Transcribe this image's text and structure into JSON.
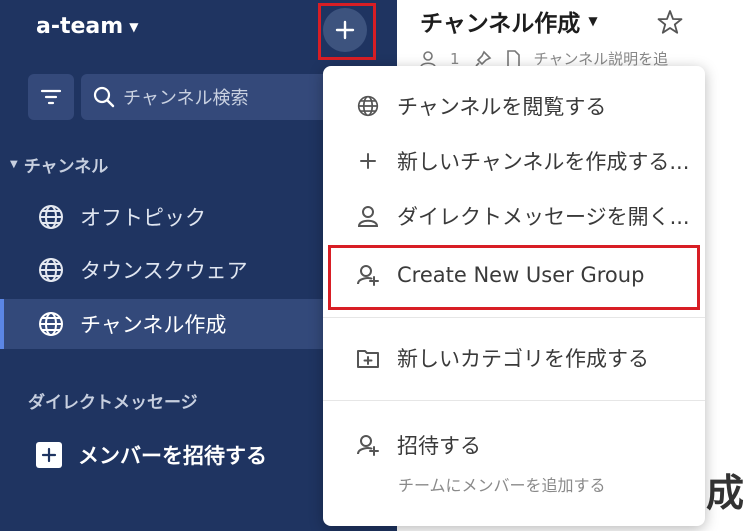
{
  "sidebar": {
    "team_name": "a-team",
    "search_placeholder": "チャンネル検索",
    "channels_header": "チャンネル",
    "channels": [
      {
        "label": "オフトピック"
      },
      {
        "label": "タウンスクウェア"
      },
      {
        "label": "チャンネル作成",
        "active": true
      }
    ],
    "dm_header": "ダイレクトメッセージ",
    "invite_label": "メンバーを招待する"
  },
  "main": {
    "channel_title": "チャンネル作成",
    "member_count": "1",
    "description_placeholder": "チャンネル説明を追",
    "big_char": "成"
  },
  "menu": {
    "browse_channels": "チャンネルを閲覧する",
    "new_channel": "新しいチャンネルを作成する...",
    "open_dm": "ダイレクトメッセージを開く...",
    "create_group": "Create New User Group",
    "new_category": "新しいカテゴリを作成する",
    "invite": "招待する",
    "invite_sub": "チームにメンバーを追加する"
  },
  "colors": {
    "sidebar_bg": "#1f3461",
    "highlight_border": "#d81e25",
    "active_indicator": "#5b86e5"
  }
}
